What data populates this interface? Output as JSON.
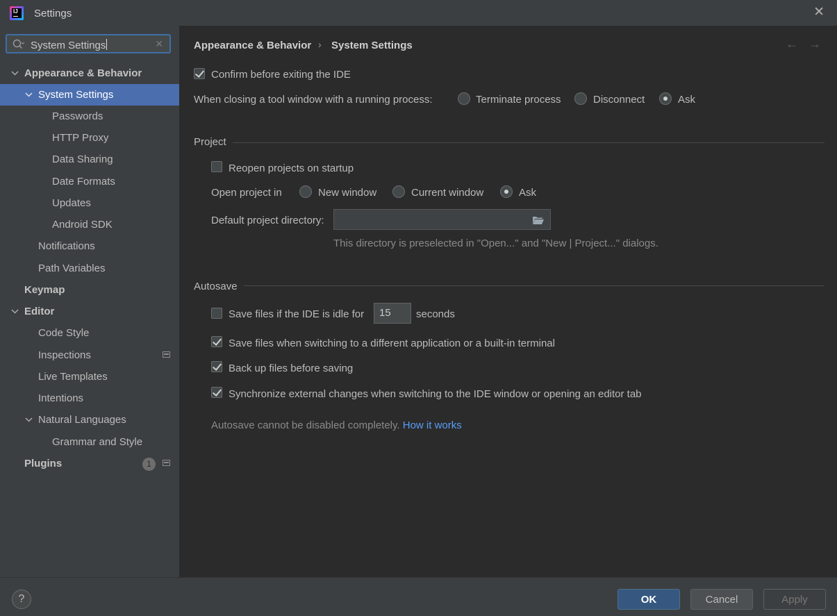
{
  "window": {
    "title": "Settings",
    "logo_text": "IJ"
  },
  "search": {
    "value": "System Settings"
  },
  "sidebar": {
    "items": [
      {
        "label": "Appearance & Behavior",
        "bold": true,
        "expanded": true
      },
      {
        "label": "System Settings",
        "selected": true,
        "expanded": true
      },
      {
        "label": "Passwords"
      },
      {
        "label": "HTTP Proxy"
      },
      {
        "label": "Data Sharing"
      },
      {
        "label": "Date Formats"
      },
      {
        "label": "Updates"
      },
      {
        "label": "Android SDK"
      },
      {
        "label": "Notifications"
      },
      {
        "label": "Path Variables"
      },
      {
        "label": "Keymap",
        "bold": true
      },
      {
        "label": "Editor",
        "bold": true,
        "expanded": true
      },
      {
        "label": "Code Style"
      },
      {
        "label": "Inspections"
      },
      {
        "label": "Live Templates"
      },
      {
        "label": "Intentions"
      },
      {
        "label": "Natural Languages",
        "expanded": true
      },
      {
        "label": "Grammar and Style"
      },
      {
        "label": "Plugins",
        "bold": true,
        "badge": "1"
      }
    ]
  },
  "breadcrumb": {
    "parent": "Appearance & Behavior",
    "current": "System Settings"
  },
  "general": {
    "confirm_exit": {
      "label": "Confirm before exiting the IDE",
      "checked": true
    },
    "closing_tool_window": {
      "label": "When closing a tool window with a running process:",
      "options": [
        "Terminate process",
        "Disconnect",
        "Ask"
      ],
      "selected": "Ask"
    }
  },
  "project": {
    "title": "Project",
    "reopen": {
      "label": "Reopen projects on startup",
      "checked": false
    },
    "open_in": {
      "label": "Open project in",
      "options": [
        "New window",
        "Current window",
        "Ask"
      ],
      "selected": "Ask"
    },
    "default_dir": {
      "label": "Default project directory:",
      "value": ""
    },
    "hint": "This directory is preselected in \"Open...\" and \"New | Project...\" dialogs."
  },
  "autosave": {
    "title": "Autosave",
    "idle": {
      "label": "Save files if the IDE is idle for",
      "value": "15",
      "suffix": "seconds",
      "checked": false
    },
    "switching": {
      "label": "Save files when switching to a different application or a built-in terminal",
      "checked": true
    },
    "backup": {
      "label": "Back up files before saving",
      "checked": true
    },
    "sync": {
      "label": "Synchronize external changes when switching to the IDE window or opening an editor tab",
      "checked": true
    },
    "note": "Autosave cannot be disabled completely.",
    "link": "How it works"
  },
  "footer": {
    "help": "?",
    "ok": "OK",
    "cancel": "Cancel",
    "apply": "Apply"
  },
  "colors": {
    "selection": "#4b6eaf",
    "link": "#589df6",
    "ok_button": "#365880"
  },
  "icons": [
    "search-icon",
    "close-icon",
    "chevron-down-icon",
    "back-arrow-icon",
    "forward-arrow-icon",
    "folder-icon",
    "help-icon"
  ]
}
